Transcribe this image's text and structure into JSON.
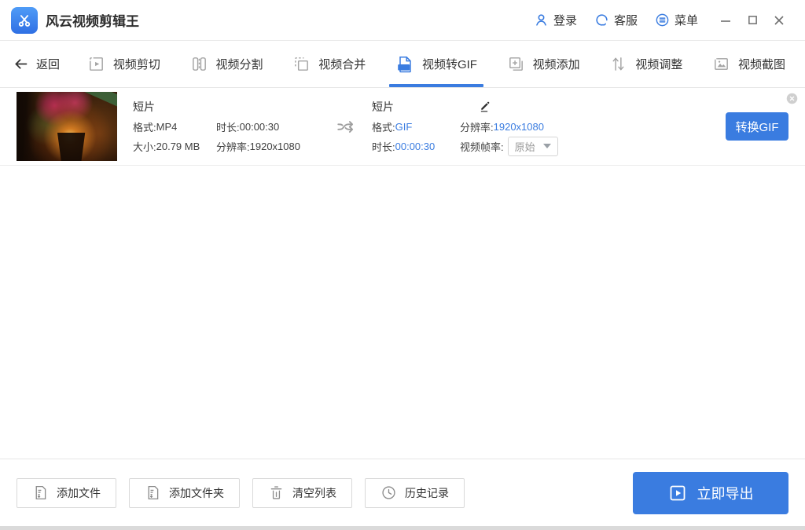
{
  "colors": {
    "primary_blue": "#3a7ce0",
    "value_blue": "#3a7ce0",
    "border_gray": "#e6e6e6"
  },
  "titlebar": {
    "app_title": "风云视频剪辑王",
    "login_label": "登录",
    "service_label": "客服",
    "menu_label": "菜单"
  },
  "nav": {
    "back_label": "返回",
    "tabs": [
      {
        "label": "视频剪切",
        "active": false
      },
      {
        "label": "视频分割",
        "active": false
      },
      {
        "label": "视频合并",
        "active": false
      },
      {
        "label": "视频转GIF",
        "active": true,
        "badge": "GIF"
      },
      {
        "label": "视频添加",
        "active": false
      },
      {
        "label": "视频调整",
        "active": false
      },
      {
        "label": "视频截图",
        "active": false
      }
    ]
  },
  "file_row": {
    "source": {
      "title": "短片",
      "format_label": "格式:",
      "format_value": "MP4",
      "duration_label": "时长:",
      "duration_value": "00:00:30",
      "size_label": "大小: ",
      "size_value": "20.79 MB",
      "resolution_label": "分辨率:",
      "resolution_value": "1920x1080"
    },
    "output": {
      "title": "短片",
      "format_label": "格式: ",
      "format_value": "GIF",
      "duration_label": "时长: ",
      "duration_value": "00:00:30",
      "resolution_label": "分辨率: ",
      "resolution_value": "1920x1080",
      "framerate_label": "视频帧率:",
      "framerate_value": "原始"
    },
    "convert_button_label": "转换GIF"
  },
  "footer": {
    "buttons": [
      {
        "label": "添加文件"
      },
      {
        "label": "添加文件夹"
      },
      {
        "label": "清空列表"
      },
      {
        "label": "历史记录"
      }
    ],
    "export_label": "立即导出"
  }
}
